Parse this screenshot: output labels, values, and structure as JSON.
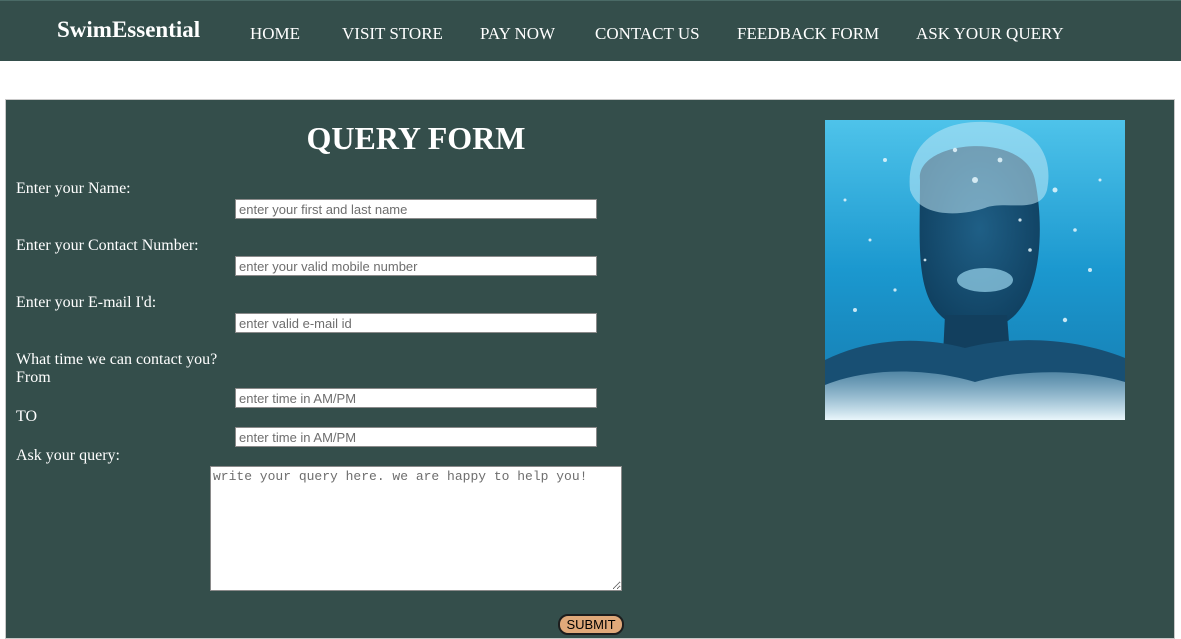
{
  "nav": {
    "brand": "SwimEssential",
    "links": [
      "HOME",
      "VISIT STORE",
      "PAY NOW",
      "CONTACT US",
      "FEEDBACK FORM",
      "ASK YOUR QUERY"
    ]
  },
  "form": {
    "title": "QUERY FORM",
    "name_label": "Enter your Name:",
    "name_placeholder": "enter your first and last name",
    "contact_label": "Enter your Contact Number:",
    "contact_placeholder": "enter your valid mobile number",
    "email_label": "Enter your E-mail I'd:",
    "email_placeholder": "enter valid e-mail id",
    "time_question": "What time we can contact you?",
    "from_label": "From",
    "from_placeholder": "enter time in AM/PM",
    "to_label": "TO",
    "to_placeholder": "enter time in AM/PM",
    "query_label": "Ask your query:",
    "query_placeholder": "write your query here. we are happy to help you!",
    "submit_label": "SUBMIT"
  },
  "image": {
    "icon": "underwater-swimmer-photo"
  },
  "colors": {
    "nav_bg": "#344e4b",
    "panel_bg": "#344e4b",
    "submit_bg": "#e0a97a",
    "water": "#1fa3d6"
  }
}
